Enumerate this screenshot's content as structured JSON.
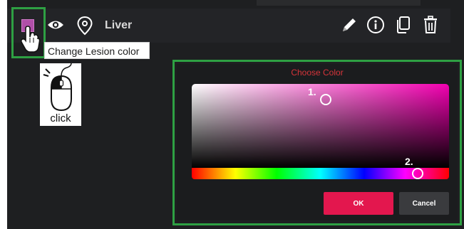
{
  "lesion_row": {
    "name": "Liver",
    "swatch_color": "#b04fa8",
    "icons": [
      "color-swatch",
      "eye-icon",
      "location-pin-icon",
      "pencil-icon",
      "info-icon",
      "copy-icon",
      "trash-icon"
    ]
  },
  "tooltip": {
    "text": "Change Lesion color"
  },
  "click_illustration": {
    "text": "click"
  },
  "color_picker": {
    "title": "Choose Color",
    "marker_1": "1.",
    "marker_2": "2.",
    "selected_hue_color": "#f200b0",
    "ok_label": "OK",
    "cancel_label": "Cancel",
    "title_color": "#d6343a",
    "ok_color": "#e3174e"
  },
  "highlight_color": "#2ea043"
}
